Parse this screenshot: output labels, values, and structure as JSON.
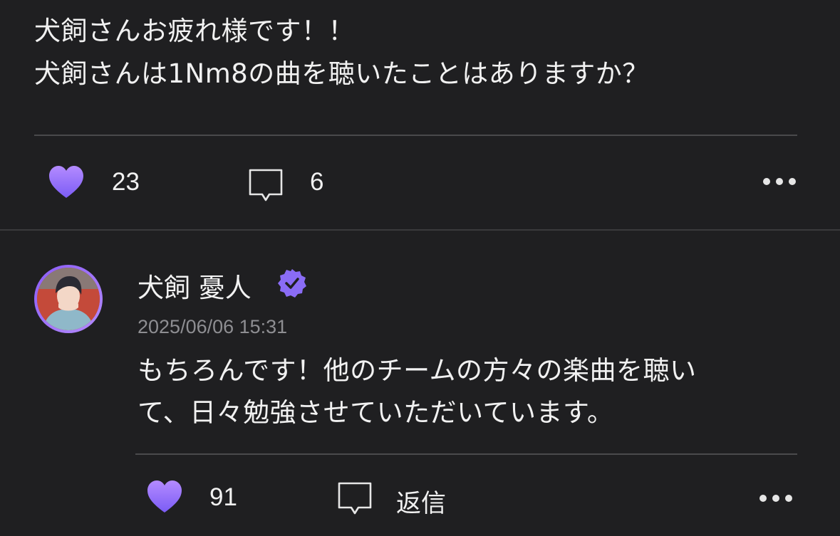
{
  "post": {
    "text_lines": [
      "犬飼さんお疲れ様です！！",
      "犬飼さんは1Nm8の曲を聴いたことはありますか？"
    ],
    "like_count": "23",
    "comment_count": "6"
  },
  "reply": {
    "username": "犬飼 憂人",
    "timestamp": "2025/06/06 15:31",
    "text_lines": [
      "もちろんです！他のチームの方々の楽曲を聴い",
      "て、日々勉強させていただいています。"
    ],
    "like_count": "91",
    "reply_label": "返信"
  },
  "colors": {
    "accent_gradient_start": "#b48bff",
    "accent_gradient_end": "#7b5cf5",
    "background": "#1f1f21",
    "verified_badge": "#8a6cf5"
  },
  "icons": {
    "like": "heart-icon",
    "comment": "speech-bubble-icon",
    "more": "more-horizontal-icon",
    "verified": "verified-badge-icon"
  }
}
